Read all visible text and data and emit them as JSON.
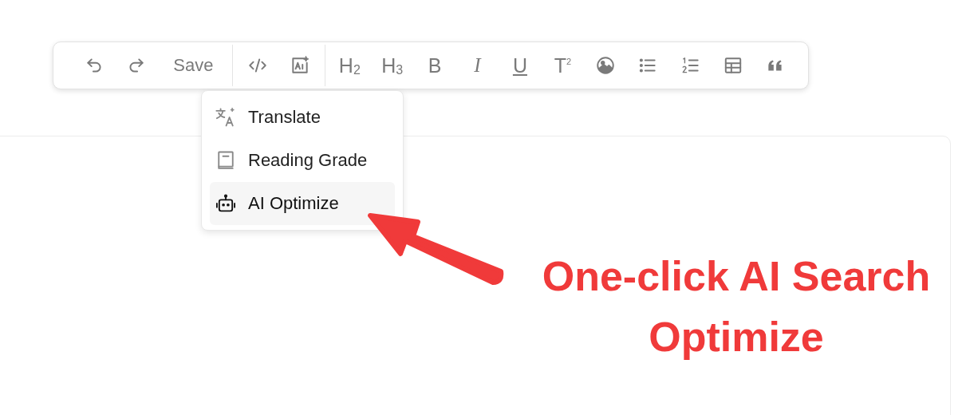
{
  "toolbar": {
    "groups": [
      [
        {
          "kind": "icon"
        },
        {
          "kind": "icon"
        },
        {
          "kind": "label",
          "label": "Save"
        }
      ],
      [
        {
          "kind": "icon"
        },
        {
          "kind": "icon"
        }
      ],
      [
        {
          "kind": "heading",
          "label": "H$_{2}$"
        },
        {
          "kind": "heading",
          "label": "H$_{3}$"
        },
        {
          "kind": "bold",
          "label": "B"
        },
        {
          "kind": "italic",
          "label": "I"
        },
        {
          "kind": "underline",
          "label": "U"
        },
        {
          "kind": "superscript",
          "label": "T$^{2}$"
        },
        {
          "kind": "icon"
        },
        {
          "kind": "icon"
        },
        {
          "kind": "icon"
        },
        {
          "kind": "icon"
        },
        {
          "kind": "icon"
        }
      ]
    ]
  },
  "menu": {
    "items": [
      {
        "label": "Translate",
        "selected": false
      },
      {
        "label": "Reading Grade",
        "selected": false
      },
      {
        "label": "AI Optimize",
        "selected": true
      }
    ]
  },
  "annotation": {
    "lines": [
      "One-click AI Search",
      "Optimize"
    ]
  }
}
